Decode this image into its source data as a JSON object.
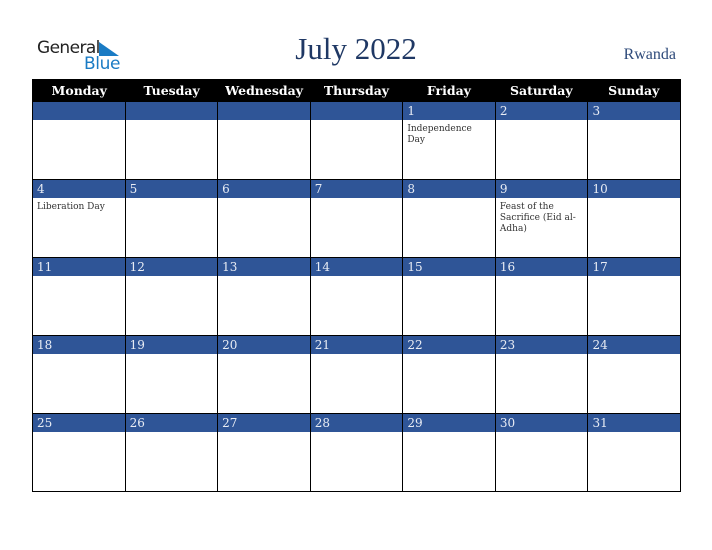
{
  "logo": {
    "line1": "General",
    "line2": "Blue"
  },
  "title": "July 2022",
  "country": "Rwanda",
  "weekdays": [
    "Monday",
    "Tuesday",
    "Wednesday",
    "Thursday",
    "Friday",
    "Saturday",
    "Sunday"
  ],
  "weeks": [
    [
      {
        "n": "",
        "e": ""
      },
      {
        "n": "",
        "e": ""
      },
      {
        "n": "",
        "e": ""
      },
      {
        "n": "",
        "e": ""
      },
      {
        "n": "1",
        "e": "Independence Day"
      },
      {
        "n": "2",
        "e": ""
      },
      {
        "n": "3",
        "e": ""
      }
    ],
    [
      {
        "n": "4",
        "e": "Liberation Day"
      },
      {
        "n": "5",
        "e": ""
      },
      {
        "n": "6",
        "e": ""
      },
      {
        "n": "7",
        "e": ""
      },
      {
        "n": "8",
        "e": ""
      },
      {
        "n": "9",
        "e": "Feast of the Sacrifice (Eid al-Adha)"
      },
      {
        "n": "10",
        "e": ""
      }
    ],
    [
      {
        "n": "11",
        "e": ""
      },
      {
        "n": "12",
        "e": ""
      },
      {
        "n": "13",
        "e": ""
      },
      {
        "n": "14",
        "e": ""
      },
      {
        "n": "15",
        "e": ""
      },
      {
        "n": "16",
        "e": ""
      },
      {
        "n": "17",
        "e": ""
      }
    ],
    [
      {
        "n": "18",
        "e": ""
      },
      {
        "n": "19",
        "e": ""
      },
      {
        "n": "20",
        "e": ""
      },
      {
        "n": "21",
        "e": ""
      },
      {
        "n": "22",
        "e": ""
      },
      {
        "n": "23",
        "e": ""
      },
      {
        "n": "24",
        "e": ""
      }
    ],
    [
      {
        "n": "25",
        "e": ""
      },
      {
        "n": "26",
        "e": ""
      },
      {
        "n": "27",
        "e": ""
      },
      {
        "n": "28",
        "e": ""
      },
      {
        "n": "29",
        "e": ""
      },
      {
        "n": "30",
        "e": ""
      },
      {
        "n": "31",
        "e": ""
      }
    ]
  ]
}
